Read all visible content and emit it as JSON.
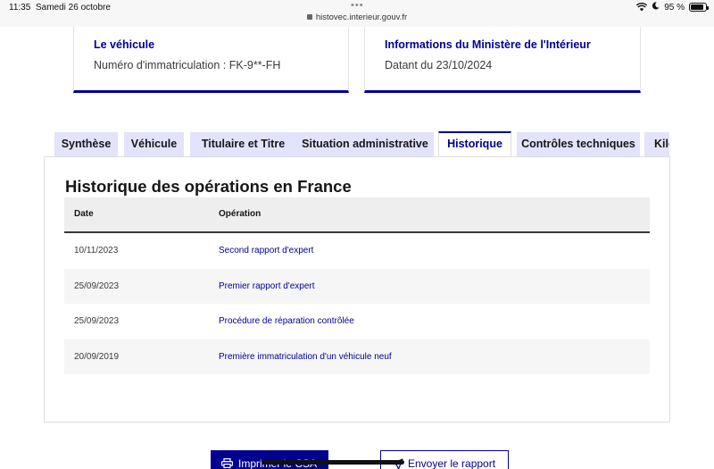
{
  "status_bar": {
    "time": "11:35",
    "date": "Samedi 26 octobre",
    "url": "histovec.interieur.gouv.fr",
    "battery": "95 %"
  },
  "cards": [
    {
      "title": "Le véhicule",
      "text": "Numéro d'immatriculation : FK-9**-FH"
    },
    {
      "title": "Informations du Ministère de l'Intérieur",
      "text": "Datant du 23/10/2024"
    }
  ],
  "tabs": [
    {
      "label": "Synthèse",
      "active": false
    },
    {
      "label": "Véhicule",
      "active": false
    },
    {
      "label": "Titulaire et Titre",
      "active": false
    },
    {
      "label": "Situation administrative",
      "active": false
    },
    {
      "label": "Historique",
      "active": true
    },
    {
      "label": "Contrôles techniques",
      "active": false
    },
    {
      "label": "Kilométrage",
      "active": false
    }
  ],
  "section": {
    "title": "Historique des opérations en France",
    "columns": [
      "Date",
      "Opération"
    ],
    "rows": [
      {
        "date": "10/11/2023",
        "operation": "Second rapport d'expert"
      },
      {
        "date": "25/09/2023",
        "operation": "Premier rapport d'expert"
      },
      {
        "date": "25/09/2023",
        "operation": "Procédure de réparation contrôlée"
      },
      {
        "date": "20/09/2019",
        "operation": "Première immatriculation d'un véhicule neuf"
      }
    ]
  },
  "actions": {
    "print_label": "Imprimer le CSA",
    "send_label": "Envoyer le rapport"
  },
  "colors": {
    "accent": "#000091",
    "tab_bg": "#e3e3fd"
  }
}
